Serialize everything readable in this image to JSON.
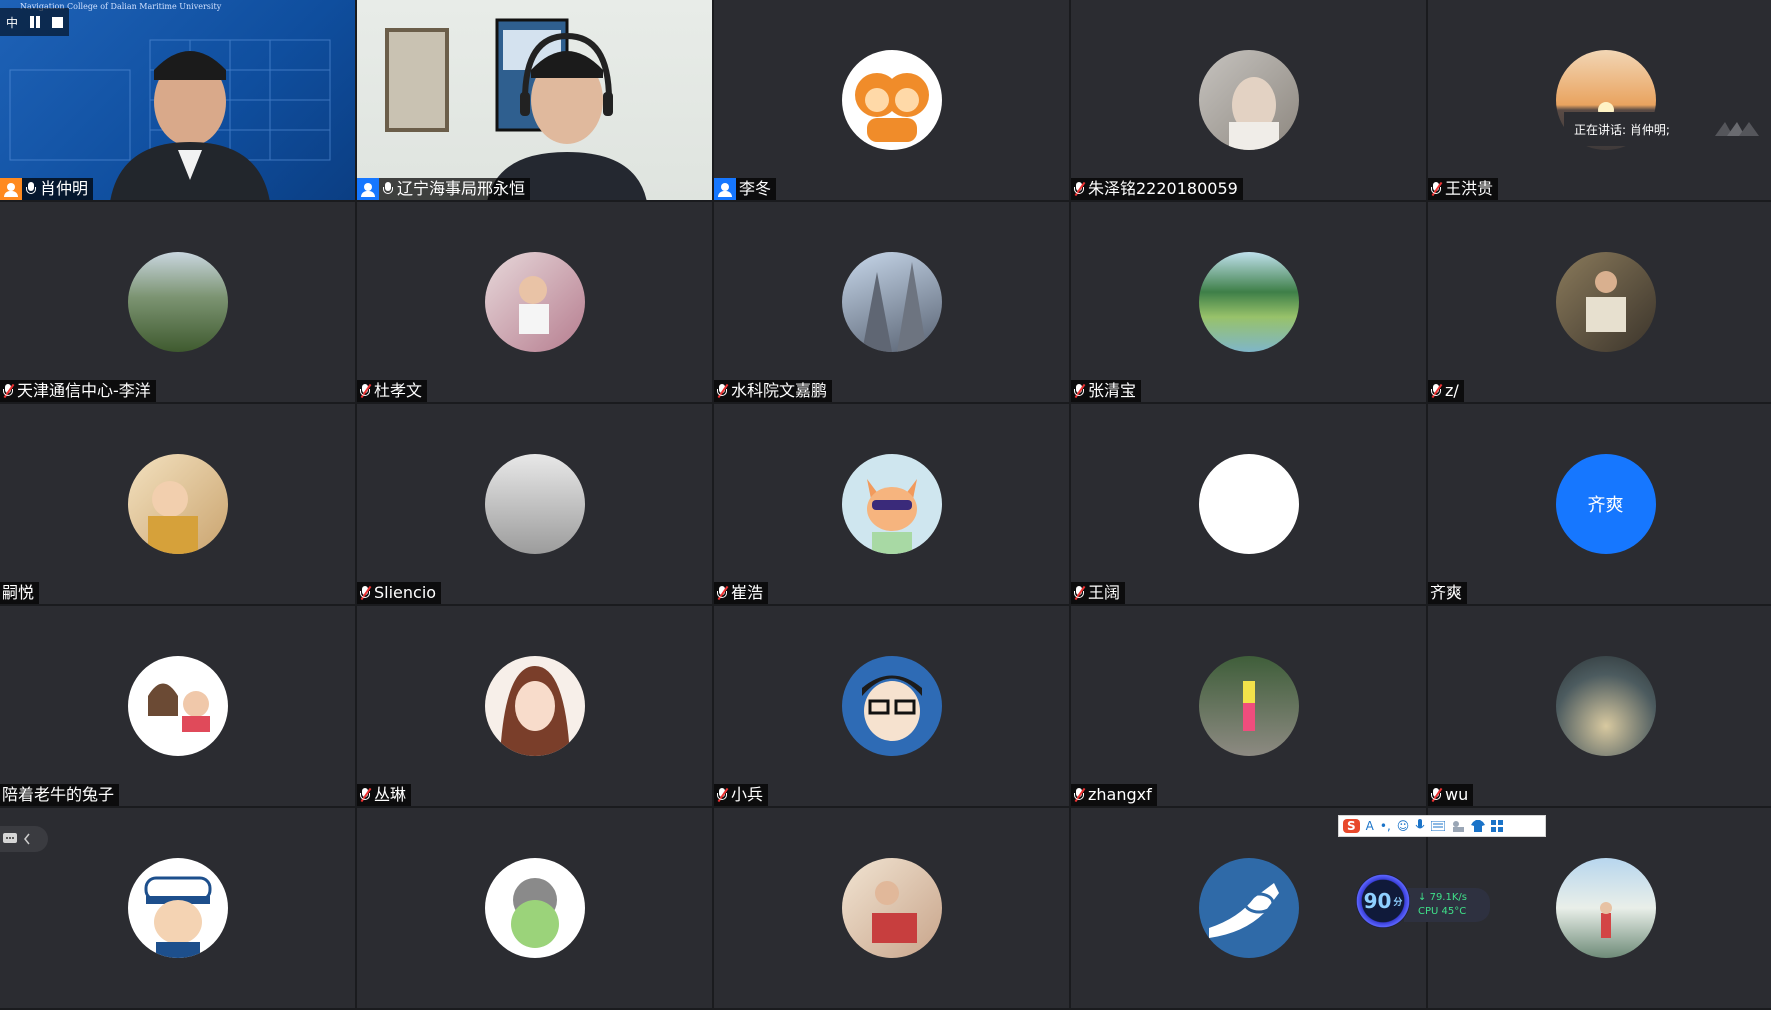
{
  "banner": {
    "text": "Navigation College of Dalian Maritime University",
    "prefix": "中"
  },
  "speaker_popup": {
    "label": "正在讲话: 肖仲明;"
  },
  "participants": [
    {
      "name": "肖仲明",
      "kind": "video",
      "mic": "on",
      "badge": "orange"
    },
    {
      "name": "辽宁海事局邢永恒",
      "kind": "video",
      "mic": "on",
      "badge": "blue"
    },
    {
      "name": "李冬",
      "kind": "avatar",
      "mic": "none",
      "badge": "blue",
      "avatar_icon": "monkeys-avatar"
    },
    {
      "name": "朱泽铭2220180059",
      "kind": "avatar",
      "mic": "muted",
      "avatar_icon": "photo-avatar"
    },
    {
      "name": "王洪贵",
      "kind": "avatar",
      "mic": "muted",
      "avatar_icon": "sunset-avatar"
    },
    {
      "name": "天津通信中心-李洋",
      "kind": "avatar",
      "mic": "muted",
      "avatar_icon": "mountain-avatar"
    },
    {
      "name": "杜孝文",
      "kind": "avatar",
      "mic": "muted",
      "avatar_icon": "child-avatar"
    },
    {
      "name": "水科院文嘉鹏",
      "kind": "avatar",
      "mic": "muted",
      "avatar_icon": "cathedral-avatar"
    },
    {
      "name": "张清宝",
      "kind": "avatar",
      "mic": "muted",
      "avatar_icon": "lake-avatar"
    },
    {
      "name": "z/",
      "kind": "avatar",
      "mic": "muted",
      "avatar_icon": "reader-avatar"
    },
    {
      "name": "嗣悦",
      "kind": "avatar",
      "mic": "none",
      "avatar_icon": "baby-avatar"
    },
    {
      "name": "Sliencio",
      "kind": "avatar",
      "mic": "muted",
      "avatar_icon": "sketch-avatar"
    },
    {
      "name": "崔浩",
      "kind": "avatar",
      "mic": "muted",
      "avatar_icon": "fox-avatar"
    },
    {
      "name": "王阔",
      "kind": "avatar",
      "mic": "muted",
      "avatar_icon": "blank-avatar"
    },
    {
      "name": "齐爽",
      "kind": "text-avatar",
      "mic": "none",
      "avatar_text": "齐爽"
    },
    {
      "name": "陪着老牛的兔子",
      "kind": "avatar",
      "mic": "none",
      "avatar_icon": "couple-avatar"
    },
    {
      "name": "丛琳",
      "kind": "avatar",
      "mic": "muted",
      "avatar_icon": "anime-girl-avatar"
    },
    {
      "name": "小兵",
      "kind": "avatar",
      "mic": "muted",
      "avatar_icon": "glasses-boy-avatar"
    },
    {
      "name": "zhangxf",
      "kind": "avatar",
      "mic": "muted",
      "avatar_icon": "walker-avatar"
    },
    {
      "name": "wu",
      "kind": "avatar",
      "mic": "muted",
      "avatar_icon": "elephant-avatar"
    },
    {
      "name": "",
      "kind": "avatar",
      "mic": "none",
      "avatar_icon": "sailor-avatar"
    },
    {
      "name": "",
      "kind": "avatar",
      "mic": "none",
      "avatar_icon": "bear-avatar"
    },
    {
      "name": "",
      "kind": "avatar",
      "mic": "none",
      "avatar_icon": "artist-avatar"
    },
    {
      "name": "",
      "kind": "avatar",
      "mic": "none",
      "avatar_icon": "fish-avatar"
    },
    {
      "name": "",
      "kind": "avatar",
      "mic": "none",
      "avatar_icon": "merlion-avatar"
    }
  ],
  "perf_widget": {
    "score": "90",
    "score_unit": "分",
    "net": "79.1K/s",
    "cpu": "CPU 45°C"
  },
  "ime": {
    "logo": "S",
    "mode": "A"
  }
}
